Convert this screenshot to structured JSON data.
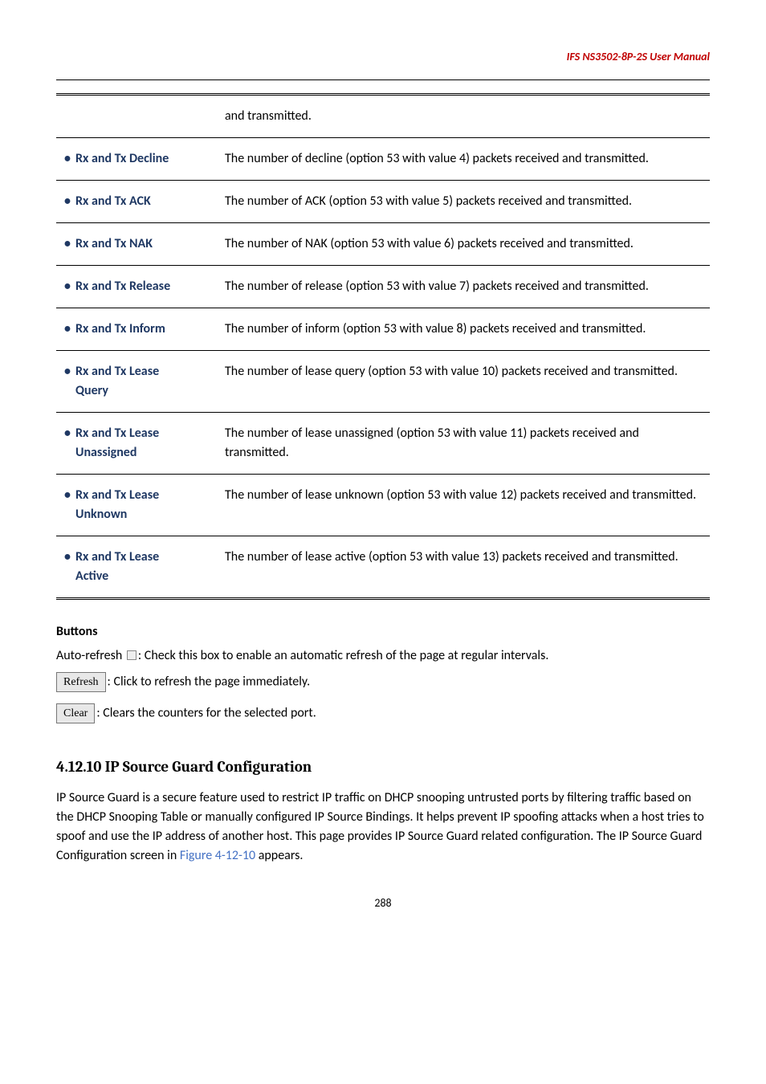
{
  "header": {
    "title": "IFS  NS3502-8P-2S  User  Manual"
  },
  "table": {
    "rows": [
      {
        "label_lines": [
          ""
        ],
        "desc": "and transmitted."
      },
      {
        "label_lines": [
          "Rx and Tx Decline"
        ],
        "desc": "The number of decline (option 53 with value 4) packets received and transmitted."
      },
      {
        "label_lines": [
          "Rx and Tx ACK"
        ],
        "desc": "The number of ACK (option 53 with value 5) packets received and transmitted."
      },
      {
        "label_lines": [
          "Rx and Tx NAK"
        ],
        "desc": "The number of NAK (option 53 with value 6) packets received and transmitted."
      },
      {
        "label_lines": [
          "Rx and Tx Release"
        ],
        "desc": "The number of release (option 53 with value 7) packets received and transmitted."
      },
      {
        "label_lines": [
          "Rx and Tx Inform"
        ],
        "desc": "The number of inform (option 53 with value 8) packets received and transmitted."
      },
      {
        "label_lines": [
          "Rx and Tx Lease",
          "Query"
        ],
        "desc": "The number of lease query (option 53 with value 10) packets received and transmitted."
      },
      {
        "label_lines": [
          "Rx and Tx Lease",
          "Unassigned"
        ],
        "desc": "The number of lease unassigned (option 53 with value 11) packets received and transmitted."
      },
      {
        "label_lines": [
          "Rx and Tx Lease",
          "Unknown"
        ],
        "desc": "The number of lease unknown (option 53 with value 12) packets received and transmitted."
      },
      {
        "label_lines": [
          "Rx and Tx Lease",
          "Active"
        ],
        "desc": "The number of lease active (option 53 with value 13) packets received and transmitted."
      }
    ]
  },
  "buttons_section": {
    "heading": "Buttons",
    "auto_refresh_prefix": "Auto-refresh ",
    "auto_refresh_suffix": ": Check this box to enable an automatic refresh of the page at regular intervals.",
    "refresh_label": "Refresh",
    "refresh_desc": ": Click to refresh the page immediately.",
    "clear_label": "Clear",
    "clear_desc": ": Clears the counters for the selected port."
  },
  "subsection": {
    "title": "4.12.10 IP Source Guard Configuration",
    "body_prefix": "IP Source Guard is a secure feature used to restrict IP traffic on DHCP snooping untrusted ports by filtering traffic based on the DHCP Snooping Table or manually configured IP Source Bindings. It helps prevent IP spoofing attacks when a host tries to spoof and use the IP address of another host. This page provides IP Source Guard related configuration. The IP Source Guard Configuration screen in ",
    "fig_ref": "Figure 4-12-10",
    "body_suffix": " appears."
  },
  "page_number": "288"
}
